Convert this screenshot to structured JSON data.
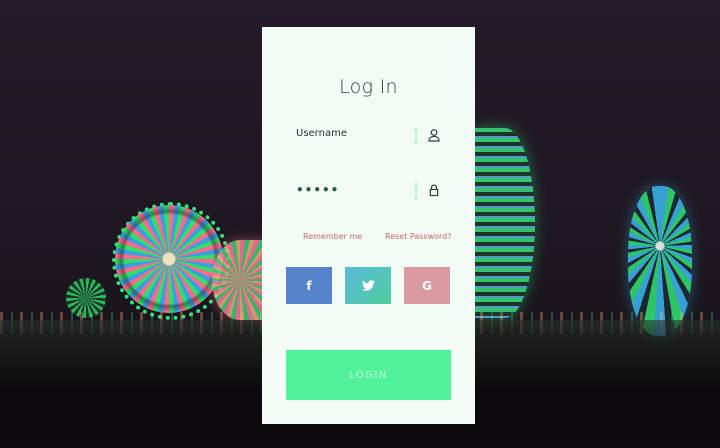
{
  "form": {
    "title": "Log In",
    "username_label": "Username",
    "password_dots": "•••••",
    "remember_label": "Remember me",
    "reset_label": "Reset Password?",
    "login_label": "LOGIN"
  },
  "social": {
    "facebook_glyph": "f",
    "google_glyph": "G"
  },
  "icons": {
    "username_icon": "user-icon",
    "password_icon": "lock-icon",
    "twitter_icon": "twitter-bird-icon"
  },
  "colors": {
    "card_bg": "#f2fcf4",
    "login_bg": "#52f29c",
    "facebook": "#5584cc",
    "twitter": "#52c3c0",
    "google": "#d89aa0",
    "link": "#c46a6e"
  }
}
